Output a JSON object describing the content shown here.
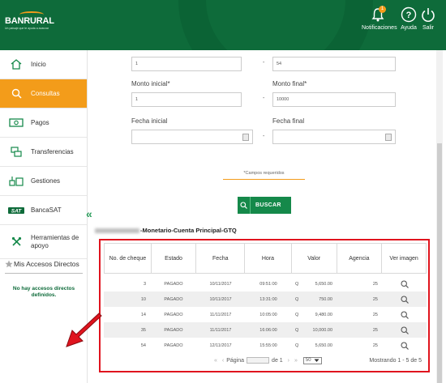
{
  "header": {
    "brand": "BANRURAL",
    "tagline": "Un paisaje que te ayuda a avanzar",
    "notifications_label": "Notificaciones",
    "notifications_count": "1",
    "help_label": "Ayuda",
    "exit_label": "Salir",
    "colors": {
      "header_bg": "#0e6b3a",
      "accent": "#f39c1a"
    }
  },
  "sidebar": {
    "items": [
      {
        "label": "Inicio",
        "icon": "home-icon",
        "active": false
      },
      {
        "label": "Consultas",
        "icon": "search-icon",
        "active": true
      },
      {
        "label": "Pagos",
        "icon": "cash-icon",
        "active": false
      },
      {
        "label": "Transferencias",
        "icon": "transfer-icon",
        "active": false
      },
      {
        "label": "Gestiones",
        "icon": "tools-icon",
        "active": false
      },
      {
        "label": "BancaSAT",
        "icon": "sat-icon",
        "active": false
      },
      {
        "label": "Herramientas de apoyo",
        "icon": "wrench-icon",
        "active": false
      }
    ],
    "accesos_title": "Mis Accesos Directos",
    "no_accesos_text": "No hay accesos directos definidos."
  },
  "form": {
    "cheque_from_value": "1",
    "cheque_to_value": "54",
    "monto_inicial_label": "Monto inicial*",
    "monto_inicial_value": "1",
    "monto_final_label": "Monto final*",
    "monto_final_value": "10000",
    "fecha_inicial_label": "Fecha inicial",
    "fecha_final_label": "Fecha final",
    "separator": "-",
    "required_note": "*Campos requeridos",
    "search_button": "BUSCAR"
  },
  "account": {
    "title": "-Monetario-Cuenta Principal-GTQ"
  },
  "table": {
    "columns": [
      "No. de cheque",
      "Estado",
      "Fecha",
      "Hora",
      "Valor",
      "Agencia",
      "Ver imagen"
    ],
    "rows": [
      {
        "cheque": "3",
        "estado": "PAGADO",
        "fecha": "10/11/2017",
        "hora": "09:51:00",
        "currency": "Q",
        "valor": "5,650.00",
        "agencia": "25"
      },
      {
        "cheque": "10",
        "estado": "PAGADO",
        "fecha": "10/11/2017",
        "hora": "13:31:00",
        "currency": "Q",
        "valor": "750.00",
        "agencia": "25"
      },
      {
        "cheque": "14",
        "estado": "PAGADO",
        "fecha": "11/11/2017",
        "hora": "10:05:00",
        "currency": "Q",
        "valor": "9,480.00",
        "agencia": "25"
      },
      {
        "cheque": "35",
        "estado": "PAGADO",
        "fecha": "11/11/2017",
        "hora": "16:06:00",
        "currency": "Q",
        "valor": "10,000.00",
        "agencia": "25"
      },
      {
        "cheque": "54",
        "estado": "PAGADO",
        "fecha": "12/11/2017",
        "hora": "15:55:00",
        "currency": "Q",
        "valor": "5,650.00",
        "agencia": "25"
      }
    ],
    "pager": {
      "page_label": "Página",
      "of_label": "de 1",
      "page_size": "50",
      "showing": "Mostrando 1 - 5 de 5"
    }
  }
}
